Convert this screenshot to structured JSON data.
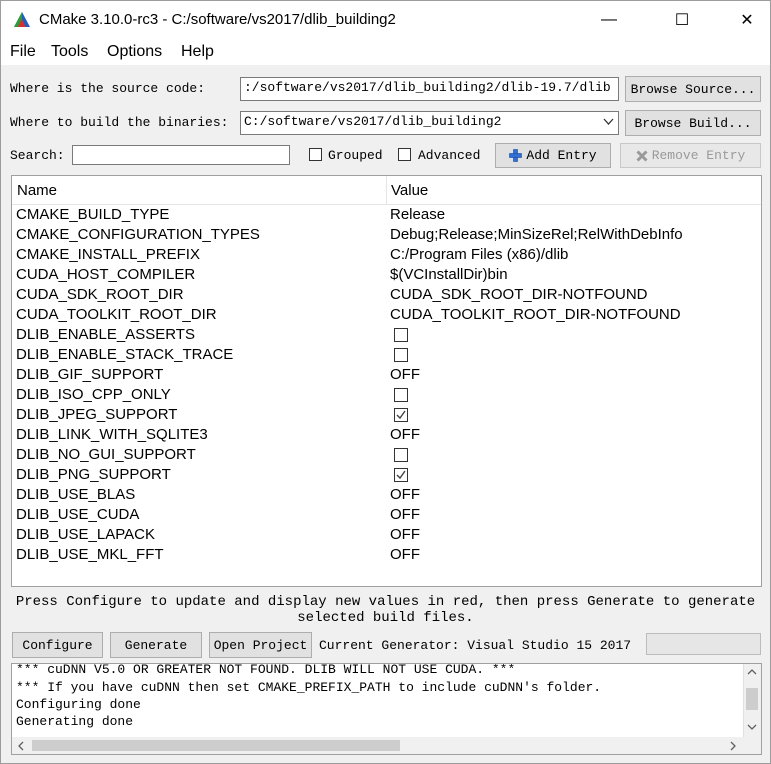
{
  "window": {
    "title": "CMake 3.10.0-rc3 - C:/software/vs2017/dlib_building2",
    "minimize_glyph": "—",
    "maximize_glyph": "☐",
    "close_glyph": "✕"
  },
  "menu": [
    "File",
    "Tools",
    "Options",
    "Help"
  ],
  "source": {
    "label": "Where is the source code:",
    "value": ":/software/vs2017/dlib_building2/dlib-19.7/dlib",
    "browse": "Browse Source..."
  },
  "build": {
    "label": "Where to build the binaries:",
    "value": "C:/software/vs2017/dlib_building2",
    "browse": "Browse Build..."
  },
  "search": {
    "label": "Search:",
    "value": "",
    "grouped": "Grouped",
    "advanced": "Advanced",
    "add_entry": "Add Entry",
    "remove_entry": "Remove Entry"
  },
  "table": {
    "headers": [
      "Name",
      "Value"
    ],
    "rows": [
      {
        "name": "CMAKE_BUILD_TYPE",
        "type": "text",
        "value": "Release"
      },
      {
        "name": "CMAKE_CONFIGURATION_TYPES",
        "type": "text",
        "value": "Debug;Release;MinSizeRel;RelWithDebInfo"
      },
      {
        "name": "CMAKE_INSTALL_PREFIX",
        "type": "text",
        "value": "C:/Program Files (x86)/dlib"
      },
      {
        "name": "CUDA_HOST_COMPILER",
        "type": "text",
        "value": "$(VCInstallDir)bin"
      },
      {
        "name": "CUDA_SDK_ROOT_DIR",
        "type": "text",
        "value": "CUDA_SDK_ROOT_DIR-NOTFOUND"
      },
      {
        "name": "CUDA_TOOLKIT_ROOT_DIR",
        "type": "text",
        "value": "CUDA_TOOLKIT_ROOT_DIR-NOTFOUND"
      },
      {
        "name": "DLIB_ENABLE_ASSERTS",
        "type": "bool",
        "checked": false
      },
      {
        "name": "DLIB_ENABLE_STACK_TRACE",
        "type": "bool",
        "checked": false
      },
      {
        "name": "DLIB_GIF_SUPPORT",
        "type": "text",
        "value": "OFF"
      },
      {
        "name": "DLIB_ISO_CPP_ONLY",
        "type": "bool",
        "checked": false
      },
      {
        "name": "DLIB_JPEG_SUPPORT",
        "type": "bool",
        "checked": true
      },
      {
        "name": "DLIB_LINK_WITH_SQLITE3",
        "type": "text",
        "value": "OFF"
      },
      {
        "name": "DLIB_NO_GUI_SUPPORT",
        "type": "bool",
        "checked": false
      },
      {
        "name": "DLIB_PNG_SUPPORT",
        "type": "bool",
        "checked": true
      },
      {
        "name": "DLIB_USE_BLAS",
        "type": "text",
        "value": "OFF"
      },
      {
        "name": "DLIB_USE_CUDA",
        "type": "text",
        "value": "OFF"
      },
      {
        "name": "DLIB_USE_LAPACK",
        "type": "text",
        "value": "OFF"
      },
      {
        "name": "DLIB_USE_MKL_FFT",
        "type": "text",
        "value": "OFF"
      }
    ]
  },
  "message": {
    "line1": "Press Configure to update and display new values in red, then press Generate to generate",
    "line2": "selected build files."
  },
  "actions": {
    "configure": "Configure",
    "generate": "Generate",
    "open_project": "Open Project",
    "generator": "Current Generator: Visual Studio 15 2017"
  },
  "output": [
    "*** cuDNN V5.0 OR GREATER NOT FOUND.  DLIB WILL NOT USE CUDA. ***",
    "*** If you have cuDNN then set CMAKE_PREFIX_PATH to include cuDNN's folder.",
    "Configuring done",
    "Generating done"
  ],
  "icons": {
    "app": "cmake-triangle-icon",
    "add": "plus-icon",
    "remove": "x-icon",
    "dropdown": "chevron-down-icon"
  },
  "colors": {
    "add_icon": "#2f6fd6",
    "remove_icon": "#9a9a9a"
  }
}
